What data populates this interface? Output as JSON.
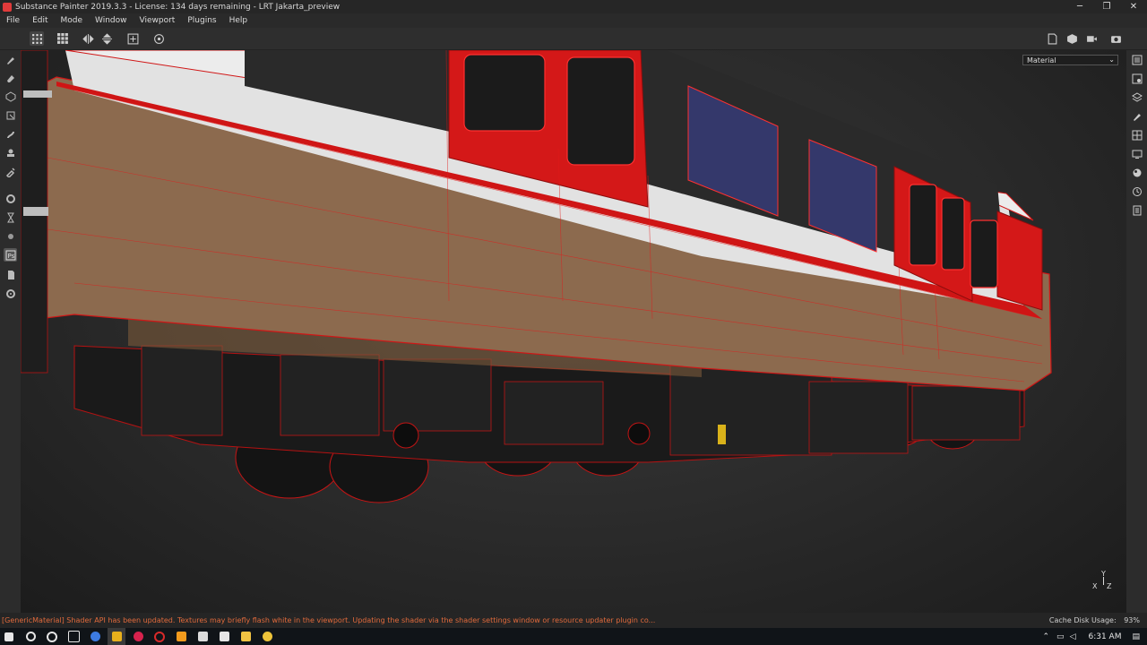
{
  "window": {
    "title": "Substance Painter 2019.3.3 - License: 134 days remaining - LRT Jakarta_preview",
    "minimize": "─",
    "maximize": "❐",
    "close": "✕"
  },
  "menu": [
    "File",
    "Edit",
    "Mode",
    "Window",
    "Viewport",
    "Plugins",
    "Help"
  ],
  "viewport": {
    "channel_select": "Material",
    "axis": {
      "y": "Y",
      "x": "X",
      "z": "Z"
    }
  },
  "status": {
    "message": "[GenericMaterial] Shader API has been updated. Textures may briefly flash white in the viewport. Updating the shader via the shader settings window or resource updater plugin co...",
    "cache_label": "Cache Disk Usage:",
    "cache_value": "93%"
  },
  "taskbar": {
    "clock": "6:31 AM",
    "apps": [
      "start-icon",
      "search-icon",
      "cortana-icon",
      "task-view-icon",
      "chrome-icon",
      "substance-painter-icon",
      "photoshop-icon",
      "opera-icon",
      "vlc-icon",
      "terminal-icon",
      "app-p-icon",
      "file-explorer-icon",
      "chrome-canary-icon"
    ]
  },
  "colors": {
    "accent_red": "#e01f1f",
    "status_warning": "#e06a3c"
  }
}
